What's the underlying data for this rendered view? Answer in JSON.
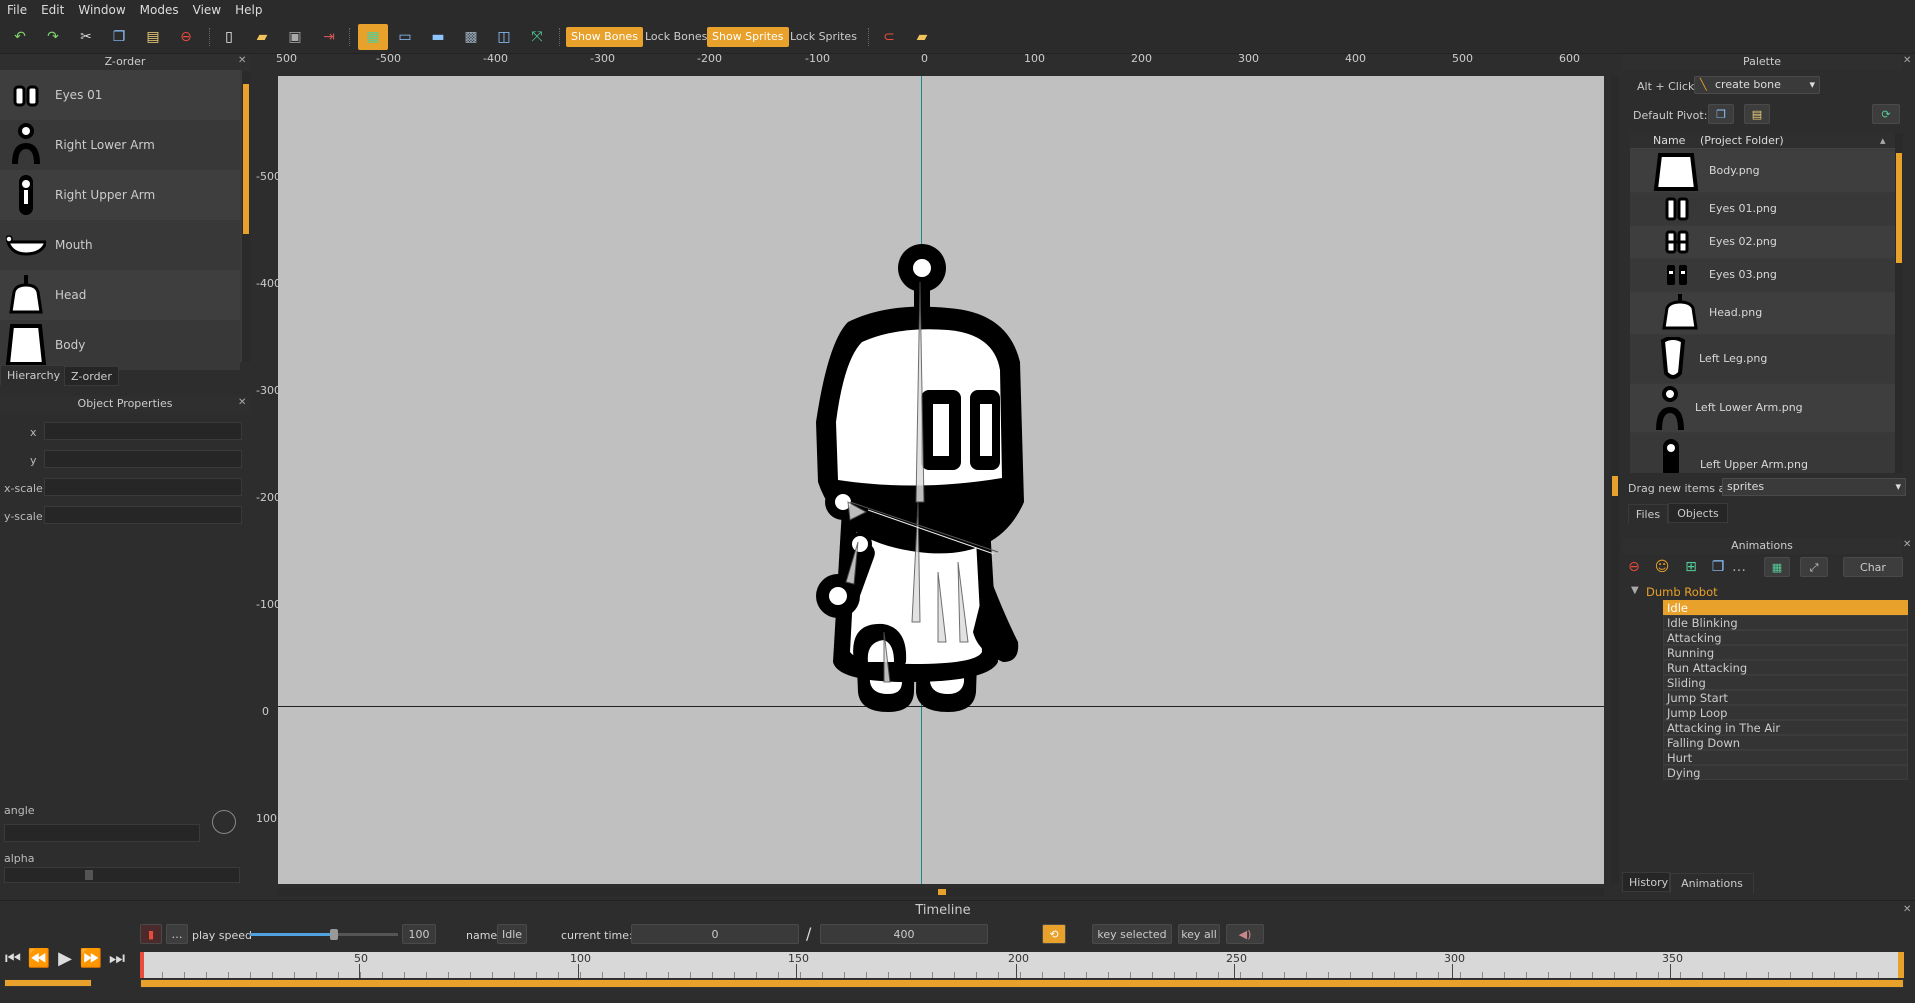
{
  "menu": [
    "File",
    "Edit",
    "Window",
    "Modes",
    "View",
    "Help"
  ],
  "toolbar": {
    "show_bones": "Show Bones",
    "lock_bones": "Lock Bones",
    "show_sprites": "Show Sprites",
    "lock_sprites": "Lock Sprites"
  },
  "zorder": {
    "title": "Z-order",
    "items": [
      {
        "label": "Eyes 01"
      },
      {
        "label": "Right Lower Arm"
      },
      {
        "label": "Right Upper Arm"
      },
      {
        "label": "Mouth"
      },
      {
        "label": "Head"
      },
      {
        "label": "Body"
      }
    ],
    "tabs": [
      "Hierarchy",
      "Z-order"
    ]
  },
  "props": {
    "title": "Object Properties",
    "x": "x",
    "y": "y",
    "xscale": "x-scale",
    "yscale": "y-scale",
    "angle": "angle",
    "alpha": "alpha"
  },
  "ruler": {
    "top": [
      "-500",
      "-400",
      "-300",
      "-200",
      "-100",
      "0",
      "100",
      "200",
      "300",
      "400",
      "500",
      "600"
    ],
    "top_partial": "500",
    "left": [
      "-500",
      "-400",
      "-300",
      "-200",
      "-100",
      "0",
      "100"
    ]
  },
  "palette": {
    "title": "Palette",
    "alt_click": "Alt + Click:",
    "create_bone": "create bone",
    "default_pivot": "Default Pivot:",
    "col_name": "Name",
    "col_folder": "(Project Folder)",
    "files": [
      "Body.png",
      "Eyes 01.png",
      "Eyes 02.png",
      "Eyes 03.png",
      "Head.png",
      "Left Leg.png",
      "Left Lower Arm.png",
      "Left Upper Arm.png"
    ],
    "drag_label": "Drag new items as",
    "drag_value": "sprites",
    "tabs": [
      "Files",
      "Objects"
    ]
  },
  "animations": {
    "title": "Animations",
    "char_maps": "Char Maps",
    "entity": "Dumb Robot",
    "items": [
      "Idle",
      "Idle Blinking",
      "Attacking",
      "Running",
      "Run Attacking",
      "Sliding",
      "Jump Start",
      "Jump Loop",
      "Attacking in The Air",
      "Falling Down",
      "Hurt",
      "Dying"
    ],
    "tabs": [
      "History",
      "Animations"
    ]
  },
  "timeline": {
    "title": "Timeline",
    "play_speed": "play speed",
    "speed_value": "100",
    "name_label": "name",
    "name_value": "Idle",
    "current_time_label": "current time:",
    "current_time": "0",
    "slash": "/",
    "length": "400",
    "key_selected": "key selected",
    "key_all": "key all",
    "ticks": [
      "50",
      "100",
      "150",
      "200",
      "250",
      "300",
      "350"
    ]
  },
  "colors": {
    "accent": "#e8a12a",
    "canvas": "#c0c0c0",
    "bg": "#2d2d2d"
  }
}
